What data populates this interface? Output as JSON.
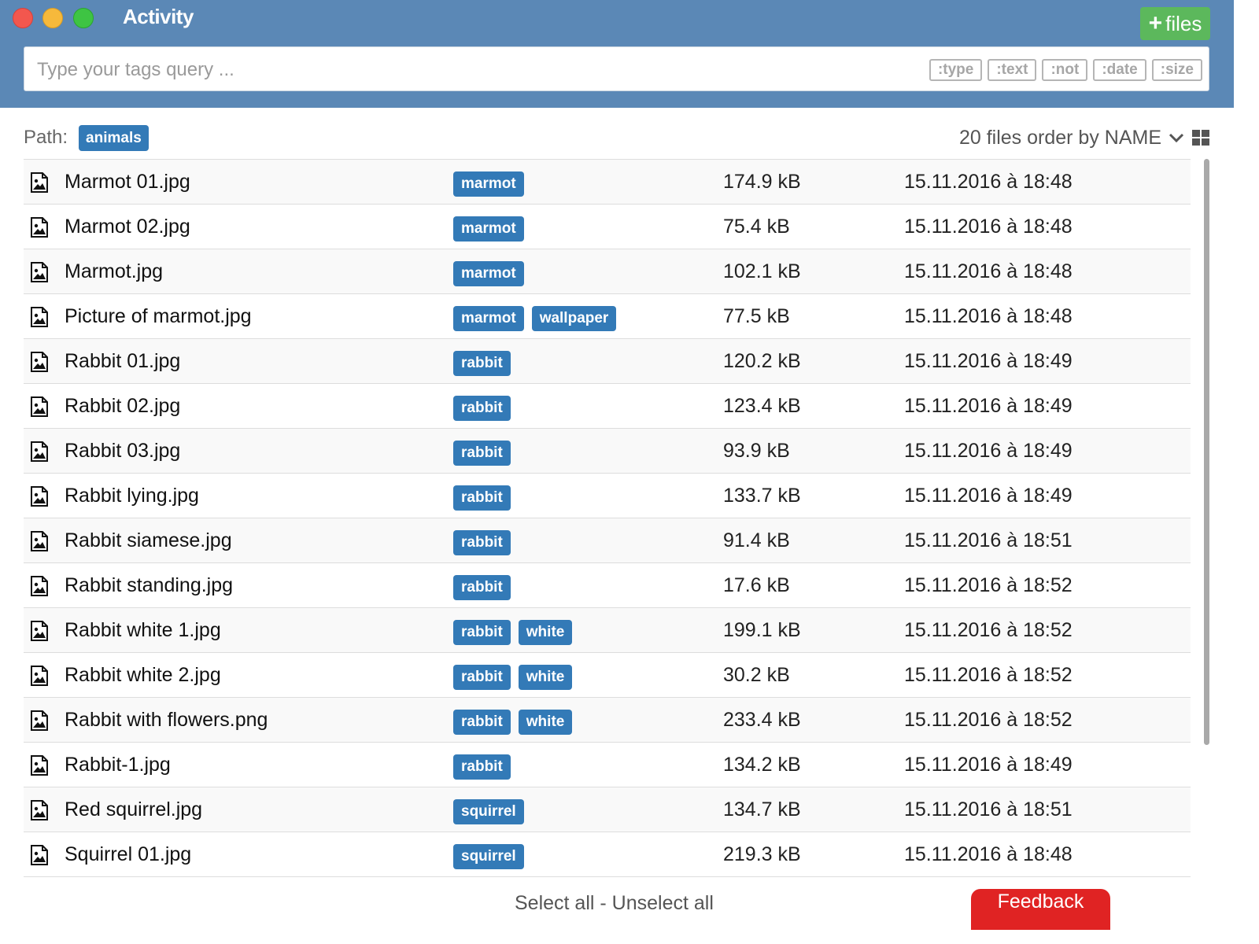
{
  "window": {
    "title": "Activity"
  },
  "header": {
    "add_files_label": "files",
    "search": {
      "placeholder": "Type your tags query ...",
      "value": ""
    },
    "filters": [
      ":type",
      ":text",
      ":not",
      ":date",
      ":size"
    ]
  },
  "path": {
    "label": "Path:",
    "chip": "animals"
  },
  "order": {
    "text": "20 files order by NAME"
  },
  "files": [
    {
      "name": "Marmot 01.jpg",
      "tags": [
        "marmot"
      ],
      "size": "174.9 kB",
      "date": "15.11.2016 à 18:48"
    },
    {
      "name": "Marmot 02.jpg",
      "tags": [
        "marmot"
      ],
      "size": "75.4 kB",
      "date": "15.11.2016 à 18:48"
    },
    {
      "name": "Marmot.jpg",
      "tags": [
        "marmot"
      ],
      "size": "102.1 kB",
      "date": "15.11.2016 à 18:48"
    },
    {
      "name": "Picture of marmot.jpg",
      "tags": [
        "marmot",
        "wallpaper"
      ],
      "size": "77.5 kB",
      "date": "15.11.2016 à 18:48"
    },
    {
      "name": "Rabbit 01.jpg",
      "tags": [
        "rabbit"
      ],
      "size": "120.2 kB",
      "date": "15.11.2016 à 18:49"
    },
    {
      "name": "Rabbit 02.jpg",
      "tags": [
        "rabbit"
      ],
      "size": "123.4 kB",
      "date": "15.11.2016 à 18:49"
    },
    {
      "name": "Rabbit 03.jpg",
      "tags": [
        "rabbit"
      ],
      "size": "93.9 kB",
      "date": "15.11.2016 à 18:49"
    },
    {
      "name": "Rabbit lying.jpg",
      "tags": [
        "rabbit"
      ],
      "size": "133.7 kB",
      "date": "15.11.2016 à 18:49"
    },
    {
      "name": "Rabbit siamese.jpg",
      "tags": [
        "rabbit"
      ],
      "size": "91.4 kB",
      "date": "15.11.2016 à 18:51"
    },
    {
      "name": "Rabbit standing.jpg",
      "tags": [
        "rabbit"
      ],
      "size": "17.6 kB",
      "date": "15.11.2016 à 18:52"
    },
    {
      "name": "Rabbit white 1.jpg",
      "tags": [
        "rabbit",
        "white"
      ],
      "size": "199.1 kB",
      "date": "15.11.2016 à 18:52"
    },
    {
      "name": "Rabbit white 2.jpg",
      "tags": [
        "rabbit",
        "white"
      ],
      "size": "30.2 kB",
      "date": "15.11.2016 à 18:52"
    },
    {
      "name": "Rabbit with flowers.png",
      "tags": [
        "rabbit",
        "white"
      ],
      "size": "233.4 kB",
      "date": "15.11.2016 à 18:52"
    },
    {
      "name": "Rabbit-1.jpg",
      "tags": [
        "rabbit"
      ],
      "size": "134.2 kB",
      "date": "15.11.2016 à 18:49"
    },
    {
      "name": "Red squirrel.jpg",
      "tags": [
        "squirrel"
      ],
      "size": "134.7 kB",
      "date": "15.11.2016 à 18:51"
    },
    {
      "name": "Squirrel 01.jpg",
      "tags": [
        "squirrel"
      ],
      "size": "219.3 kB",
      "date": "15.11.2016 à 18:48"
    }
  ],
  "footer": {
    "select_all": "Select all",
    "separator": " - ",
    "unselect_all": "Unselect all",
    "feedback": "Feedback"
  },
  "colors": {
    "titlebar": "#5b88b6",
    "tag": "#337ab7",
    "add_button": "#5cb85c",
    "feedback": "#e02323"
  },
  "icons": {
    "file": "image-file-icon",
    "order": "chevron-down-icon",
    "view": "grid-view-icon",
    "add": "plus-icon"
  }
}
